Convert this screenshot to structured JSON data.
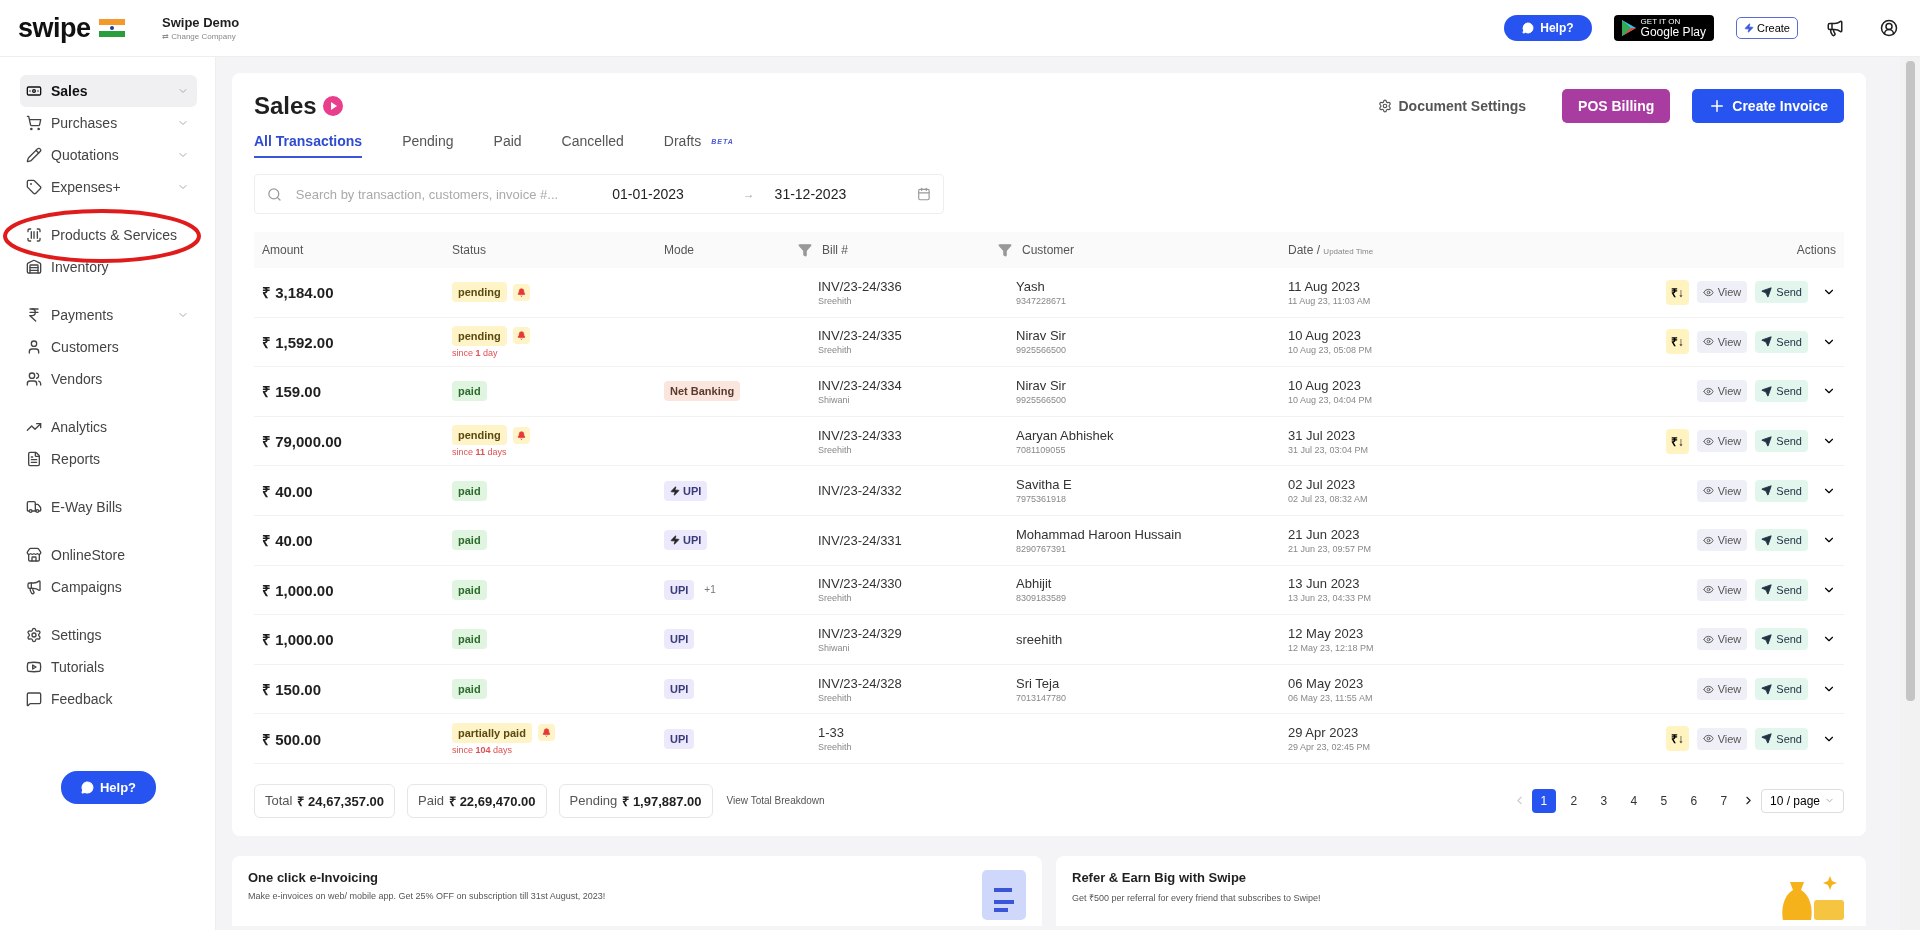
{
  "topbar": {
    "logo": "swipe",
    "company": "Swipe Demo",
    "change_company": "⇄ Change Company",
    "help": "Help?",
    "store_badge": {
      "small": "GET IT ON",
      "big": "Google Play"
    },
    "create": "Create"
  },
  "sidebar": {
    "groups": [
      {
        "items": [
          {
            "label": "Sales",
            "expandable": true,
            "selected": true
          },
          {
            "label": "Purchases",
            "expandable": true,
            "selected": false
          },
          {
            "label": "Quotations",
            "expandable": true,
            "selected": false
          },
          {
            "label": "Expenses+",
            "expandable": true,
            "selected": false
          }
        ]
      },
      {
        "items": [
          {
            "label": "Products & Services",
            "expandable": false,
            "selected": false
          },
          {
            "label": "Inventory",
            "expandable": false,
            "selected": false
          }
        ]
      },
      {
        "items": [
          {
            "label": "Payments",
            "expandable": true,
            "selected": false
          },
          {
            "label": "Customers",
            "expandable": false,
            "selected": false
          },
          {
            "label": "Vendors",
            "expandable": false,
            "selected": false
          }
        ]
      },
      {
        "items": [
          {
            "label": "Analytics",
            "expandable": false,
            "selected": false
          },
          {
            "label": "Reports",
            "expandable": false,
            "selected": false
          }
        ]
      },
      {
        "items": [
          {
            "label": "E-Way Bills",
            "expandable": false,
            "selected": false
          }
        ]
      },
      {
        "items": [
          {
            "label": "OnlineStore",
            "expandable": false,
            "selected": false
          },
          {
            "label": "Campaigns",
            "expandable": false,
            "selected": false
          }
        ]
      },
      {
        "items": [
          {
            "label": "Settings",
            "expandable": false,
            "selected": false
          },
          {
            "label": "Tutorials",
            "expandable": false,
            "selected": false
          },
          {
            "label": "Feedback",
            "expandable": false,
            "selected": false
          }
        ]
      }
    ],
    "help": "Help?"
  },
  "page": {
    "title": "Sales",
    "document_settings": "Document Settings",
    "pos_billing": "POS Billing",
    "create_invoice": "Create Invoice"
  },
  "tabs": [
    {
      "label": "All Transactions",
      "selected": true
    },
    {
      "label": "Pending",
      "selected": false
    },
    {
      "label": "Paid",
      "selected": false
    },
    {
      "label": "Cancelled",
      "selected": false
    },
    {
      "label": "Drafts",
      "badge": "BETA",
      "selected": false
    }
  ],
  "search": {
    "placeholder": "Search by transaction, customers, invoice #...",
    "date_from": "01-01-2023",
    "separator": "→",
    "date_to": "31-12-2023"
  },
  "table": {
    "columns": [
      {
        "label": "Amount",
        "filter": false
      },
      {
        "label": "Status",
        "filter": false
      },
      {
        "label": "Mode",
        "filter": false
      },
      {
        "label": "Bill #",
        "filter": true
      },
      {
        "label": "Customer",
        "filter": true
      },
      {
        "label": "Date / ",
        "sub": "Updated Time",
        "filter": false
      },
      {
        "label": "Actions",
        "filter": false
      }
    ],
    "rows": [
      {
        "amount": "₹ 3,184.00",
        "status": {
          "kind": "pending",
          "label": "pending",
          "alert": true
        },
        "bill": "INV/23-24/336",
        "created_by": "Sreehith",
        "customer": "Yash",
        "phone": "9347228671",
        "date": "11 Aug 2023",
        "updated": "11 Aug 23, 11:03 AM",
        "record_payment": "₹↓",
        "view": "View",
        "send": "Send"
      },
      {
        "amount": "₹ 1,592.00",
        "status": {
          "kind": "pending",
          "label": "pending",
          "alert": true,
          "note": "since **1** day"
        },
        "bill": "INV/23-24/335",
        "created_by": "Sreehith",
        "customer": "Nirav Sir",
        "phone": "9925566500",
        "date": "10 Aug 2023",
        "updated": "10 Aug 23, 05:08 PM",
        "record_payment": "₹↓",
        "view": "View",
        "send": "Send"
      },
      {
        "amount": "₹ 159.00",
        "status": {
          "kind": "paid",
          "label": "paid",
          "alert": false
        },
        "mode": {
          "kind": "bank",
          "label": "Net Banking",
          "instant": false
        },
        "bill": "INV/23-24/334",
        "created_by": "Shiwani",
        "customer": "Nirav Sir",
        "phone": "9925566500",
        "date": "10 Aug 2023",
        "updated": "10 Aug 23, 04:04 PM",
        "view": "View",
        "send": "Send"
      },
      {
        "amount": "₹ 79,000.00",
        "status": {
          "kind": "pending",
          "label": "pending",
          "alert": true,
          "note": "since **11** days"
        },
        "bill": "INV/23-24/333",
        "created_by": "Sreehith",
        "customer": "Aaryan Abhishek",
        "phone": "7081109055",
        "date": "31 Jul 2023",
        "updated": "31 Jul 23, 03:04 PM",
        "record_payment": "₹↓",
        "view": "View",
        "send": "Send"
      },
      {
        "amount": "₹ 40.00",
        "status": {
          "kind": "paid",
          "label": "paid",
          "alert": false
        },
        "mode": {
          "kind": "upi",
          "label": "UPI",
          "instant": true
        },
        "bill": "INV/23-24/332",
        "customer": "Savitha E",
        "phone": "7975361918",
        "date": "02 Jul 2023",
        "updated": "02 Jul 23, 08:32 AM",
        "view": "View",
        "send": "Send"
      },
      {
        "amount": "₹ 40.00",
        "status": {
          "kind": "paid",
          "label": "paid",
          "alert": false
        },
        "mode": {
          "kind": "upi",
          "label": "UPI",
          "instant": true
        },
        "bill": "INV/23-24/331",
        "customer": "Mohammad Haroon Hussain",
        "phone": "8290767391",
        "date": "21 Jun 2023",
        "updated": "21 Jun 23, 09:57 PM",
        "view": "View",
        "send": "Send"
      },
      {
        "amount": "₹ 1,000.00",
        "status": {
          "kind": "paid",
          "label": "paid",
          "alert": false
        },
        "mode": {
          "kind": "upi",
          "label": "UPI",
          "instant": false,
          "extra": "+1"
        },
        "bill": "INV/23-24/330",
        "created_by": "Sreehith",
        "customer": "Abhijit",
        "phone": "8309183589",
        "date": "13 Jun 2023",
        "updated": "13 Jun 23, 04:33 PM",
        "view": "View",
        "send": "Send"
      },
      {
        "amount": "₹ 1,000.00",
        "status": {
          "kind": "paid",
          "label": "paid",
          "alert": false
        },
        "mode": {
          "kind": "upi",
          "label": "UPI",
          "instant": false
        },
        "bill": "INV/23-24/329",
        "created_by": "Shiwani",
        "customer": "sreehith",
        "date": "12 May 2023",
        "updated": "12 May 23, 12:18 PM",
        "view": "View",
        "send": "Send"
      },
      {
        "amount": "₹ 150.00",
        "status": {
          "kind": "paid",
          "label": "paid",
          "alert": false
        },
        "mode": {
          "kind": "upi",
          "label": "UPI",
          "instant": false
        },
        "bill": "INV/23-24/328",
        "created_by": "Sreehith",
        "customer": "Sri Teja",
        "phone": "7013147780",
        "date": "06 May 2023",
        "updated": "06 May 23, 11:55 AM",
        "view": "View",
        "send": "Send"
      },
      {
        "amount": "₹ 500.00",
        "status": {
          "kind": "pending",
          "label": "partially paid",
          "alert": true,
          "note": "since **104** days"
        },
        "mode": {
          "kind": "upi",
          "label": "UPI",
          "instant": false
        },
        "bill": "1-33",
        "created_by": "Sreehith",
        "date": "29 Apr 2023",
        "updated": "29 Apr 23, 02:45 PM",
        "record_payment": "₹↓",
        "view": "View",
        "send": "Send"
      }
    ]
  },
  "totals": [
    {
      "label": "Total",
      "value": "₹ 24,67,357.00"
    },
    {
      "label": "Paid",
      "value": "₹ 22,69,470.00"
    },
    {
      "label": "Pending",
      "value": "₹ 1,97,887.00"
    }
  ],
  "breakdown_link": "View Total Breakdown",
  "pagination": {
    "pages": [
      {
        "label": "1",
        "selected": true
      },
      {
        "label": "2",
        "selected": false
      },
      {
        "label": "3",
        "selected": false
      },
      {
        "label": "4",
        "selected": false
      },
      {
        "label": "5",
        "selected": false
      },
      {
        "label": "6",
        "selected": false
      },
      {
        "label": "7",
        "selected": false
      }
    ],
    "per_page": "10 / page"
  },
  "promos": [
    {
      "title": "One click e-Invoicing",
      "text": "Make e-invoices on web/ mobile app. Get 25% OFF on subscription till 31st August, 2023!"
    },
    {
      "title": "Refer & Earn Big with Swipe",
      "text": "Get ₹500 per referral for every friend that subscribes to Swipe!"
    }
  ]
}
